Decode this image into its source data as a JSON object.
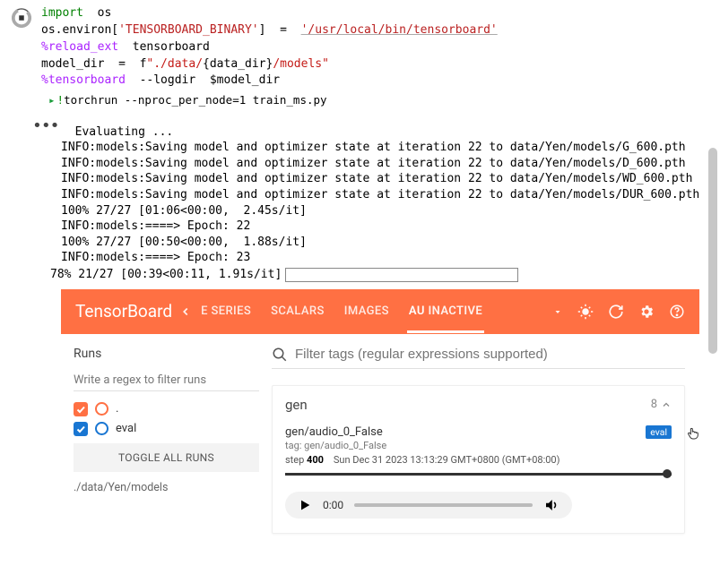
{
  "cell1": {
    "kw_import": "import",
    "os": "os",
    "line2a": "os.environ[",
    "env_key": "'TENSORBOARD_BINARY'",
    "line2b": "]  =  ",
    "env_val": "'/usr/local/bin/tensorboard'",
    "reload": "%reload_ext",
    "reload_arg": "  tensorboard",
    "modeldir_a": "model_dir  =  f",
    "modeldir_str1": "\"./data/",
    "modeldir_brace": "{data_dir}",
    "modeldir_str2": "/models\"",
    "tensorboard": "%tensorboard",
    "tb_args": "  --logdir  $model_dir"
  },
  "run_cell": {
    "bang": "!",
    "cmd": "torchrun  --nproc_per_node=1  train_ms.py"
  },
  "output_lines": [
    "Evaluating ...",
    "INFO:models:Saving model and optimizer state at iteration 22 to data/Yen/models/G_600.pth",
    "INFO:models:Saving model and optimizer state at iteration 22 to data/Yen/models/D_600.pth",
    "INFO:models:Saving model and optimizer state at iteration 22 to data/Yen/models/WD_600.pth",
    "INFO:models:Saving model and optimizer state at iteration 22 to data/Yen/models/DUR_600.pth",
    "100% 27/27 [01:06<00:00,  2.45s/it]",
    "INFO:models:====> Epoch: 22",
    "100% 27/27 [00:50<00:00,  1.88s/it]",
    "INFO:models:====> Epoch: 23"
  ],
  "progress": "78% 21/27 [00:39<00:11,  1.91s/it]",
  "tb": {
    "title": "TensorBoard",
    "tabs": {
      "t0": "E SERIES",
      "t1": "SCALARS",
      "t2": "IMAGES",
      "t3": "AU",
      "inactive": "INACTIVE"
    },
    "sidebar": {
      "runs_title": "Runs",
      "regex_label": "Write a regex to filter runs",
      "run_dot": ".",
      "run_eval": "eval",
      "toggle_all": "TOGGLE ALL RUNS",
      "path": "./data/Yen/models"
    },
    "main": {
      "filter_placeholder": "Filter tags (regular expressions supported)",
      "tag_name": "gen",
      "tag_count": "8",
      "audio": {
        "badge": "eval",
        "title": "gen/audio_0_False",
        "sub": "tag: gen/audio_0_False",
        "step_label": "step ",
        "step_val": "400",
        "date": "Sun Dec 31 2023 13:13:29 GMT+0800 (GMT+08:00)",
        "time": "0:00"
      }
    }
  }
}
